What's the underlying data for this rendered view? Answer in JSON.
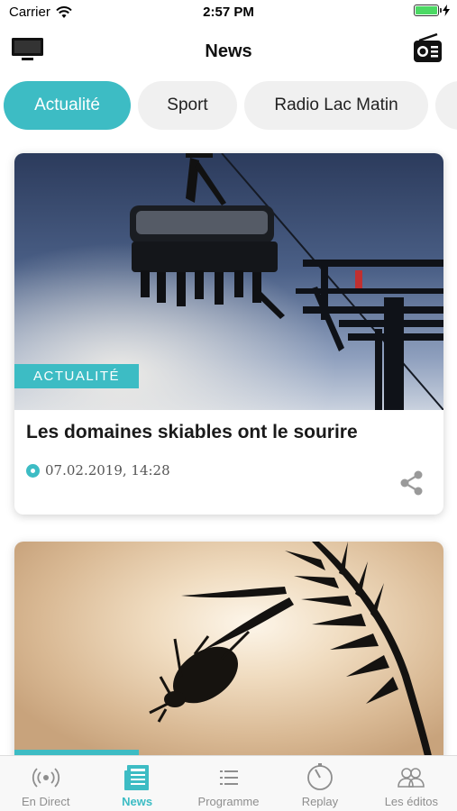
{
  "status_bar": {
    "carrier": "Carrier",
    "time": "2:57 PM",
    "battery_level": 1.0
  },
  "nav": {
    "title": "News",
    "left_icon": "tv-icon",
    "right_icon": "radio-icon"
  },
  "tabs": [
    {
      "label": "Actualité",
      "active": true
    },
    {
      "label": "Sport",
      "active": false
    },
    {
      "label": "Radio Lac Matin",
      "active": false
    },
    {
      "label": "",
      "active": false
    }
  ],
  "articles": [
    {
      "category": "ACTUALITÉ",
      "title": "Les domaines skiables ont le sourire",
      "date": "07.02.2019, 14:28"
    },
    {
      "category": "",
      "title": "",
      "date": ""
    }
  ],
  "tab_bar": {
    "items": [
      {
        "label": "En Direct",
        "icon": "broadcast-icon",
        "active": false
      },
      {
        "label": "News",
        "icon": "newspaper-icon",
        "active": true
      },
      {
        "label": "Programme",
        "icon": "list-icon",
        "active": false
      },
      {
        "label": "Replay",
        "icon": "replay-icon",
        "active": false
      },
      {
        "label": "Les éditos",
        "icon": "people-icon",
        "active": false
      }
    ]
  },
  "colors": {
    "accent": "#3dbcc4",
    "inactive": "#8e8e8e"
  }
}
